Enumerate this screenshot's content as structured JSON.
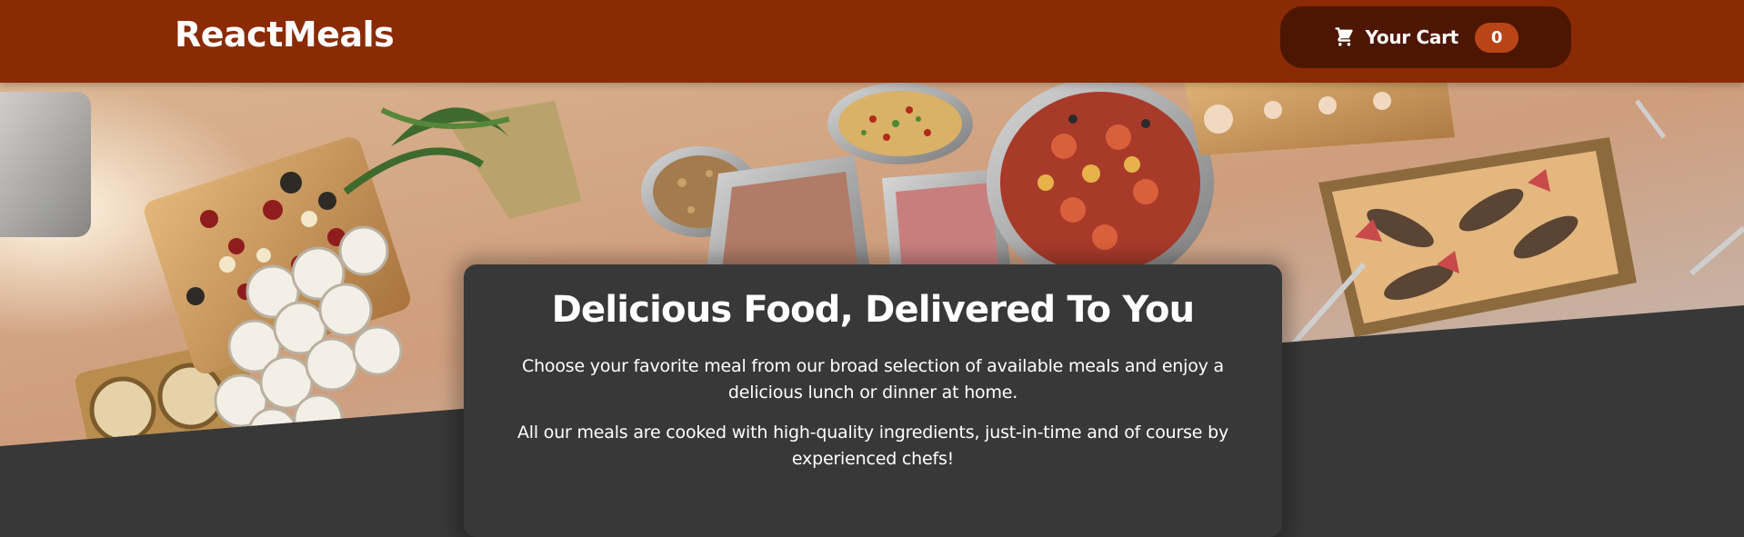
{
  "header": {
    "brand": "ReactMeals",
    "cart": {
      "label": "Your Cart",
      "count": "0",
      "icon": "cart-icon"
    }
  },
  "hero": {
    "image": "meals-buffet-image"
  },
  "summary": {
    "title": "Delicious Food, Delivered To You",
    "paragraph_1": "Choose your favorite meal from our broad selection of available meals and enjoy a delicious lunch or dinner at home.",
    "paragraph_2": "All our meals are cooked with high-quality ingredients, just-in-time and of course by experienced chefs!"
  },
  "colors": {
    "header_bg": "#8a2b06",
    "cart_button_bg": "#4d1601",
    "cart_badge_bg": "#b94517",
    "page_bg": "#383838",
    "text": "#ffffff"
  }
}
